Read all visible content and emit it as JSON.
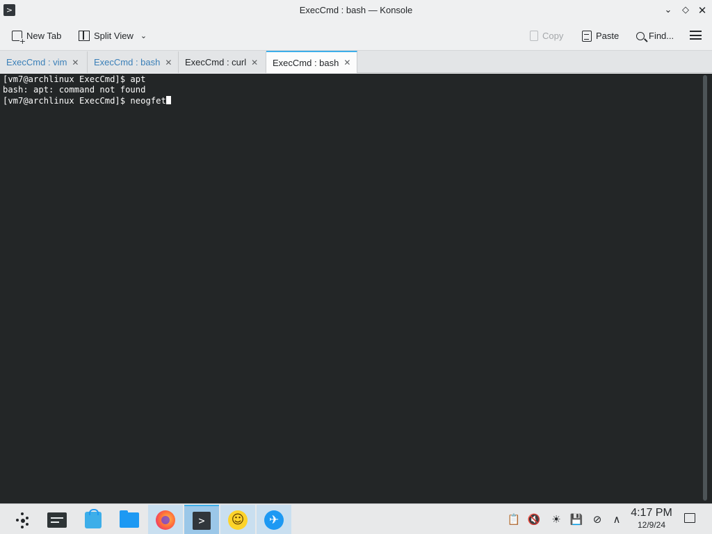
{
  "window": {
    "title": "ExecCmd : bash — Konsole",
    "app_icon_glyph": ">",
    "minimize_glyph": "⌄",
    "maximize_glyph": "◇",
    "close_glyph": "✕"
  },
  "toolbar": {
    "new_tab": "New Tab",
    "split_view": "Split View",
    "split_chevron": "⌄",
    "copy": "Copy",
    "paste": "Paste",
    "find": "Find...",
    "menu_icon": "hamburger-menu-icon"
  },
  "tabs": [
    {
      "label": "ExecCmd : vim",
      "close": "✕"
    },
    {
      "label": "ExecCmd : bash",
      "close": "✕"
    },
    {
      "label": "ExecCmd : curl",
      "close": "✕"
    },
    {
      "label": "ExecCmd : bash",
      "close": "✕"
    }
  ],
  "active_tab_index": 3,
  "terminal": {
    "lines": [
      "[vm7@archlinux ExecCmd]$ apt",
      "bash: apt: command not found",
      "[vm7@archlinux ExecCmd]$ neogfet"
    ],
    "background": "#232627",
    "foreground": "#fcfcfc"
  },
  "taskbar": {
    "apps": [
      "application-launcher-icon",
      "system-settings-icon",
      "discover-store-icon",
      "dolphin-files-icon",
      "firefox-icon",
      "konsole-icon",
      "emoji-icon",
      "browser-globe-icon"
    ],
    "konsole_glyph": ">",
    "smile_glyph": "☺",
    "globe_glyph": "✈"
  },
  "tray": {
    "clipboard": "📋",
    "volume_muted": "🔇",
    "brightness": "☀",
    "storage": "💾",
    "network": "⊘",
    "expand": "∧"
  },
  "clock": {
    "time": "4:17 PM",
    "date": "12/9/24"
  },
  "accent": "#3daee9"
}
